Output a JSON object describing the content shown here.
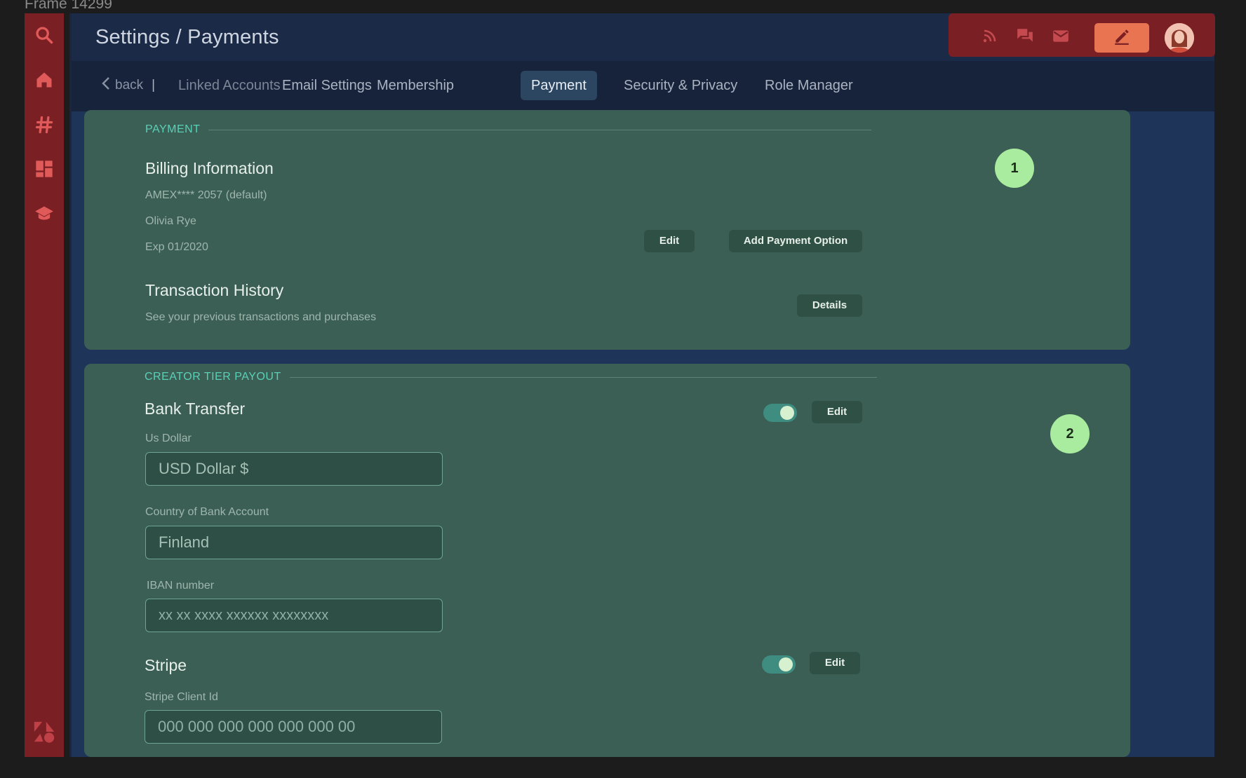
{
  "frame_label": "Frame 14299",
  "sidebar": {
    "icons": [
      "search-icon",
      "home-icon",
      "hashtag-icon",
      "dashboard-icon",
      "graduation-cap-icon",
      "shapes-logo-icon"
    ]
  },
  "header": {
    "title": "Settings / Payments",
    "actions": [
      "rss-icon",
      "chat-icon",
      "mail-icon",
      "edit-icon",
      "avatar"
    ]
  },
  "tabs": {
    "back_label": "back",
    "separator": "|",
    "items": [
      {
        "label": "Linked Accounts"
      },
      {
        "label": "Email Settings"
      },
      {
        "label": "Membership"
      },
      {
        "label": "Payment",
        "active": true
      },
      {
        "label": "Security & Privacy"
      },
      {
        "label": "Role Manager"
      }
    ]
  },
  "payment": {
    "section_title": "PAYMENT",
    "badge": "1",
    "billing": {
      "title": "Billing Information",
      "card": "AMEX**** 2057 (default)",
      "name": "Olivia Rye",
      "expiry": "Exp 01/2020",
      "edit_label": "Edit",
      "add_label": "Add Payment Option"
    },
    "history": {
      "title": "Transaction History",
      "description": "See your previous transactions and purchases",
      "details_label": "Details"
    }
  },
  "payout": {
    "section_title": "CREATOR TIER PAYOUT",
    "badge": "2",
    "bank": {
      "title": "Bank Transfer",
      "enabled": true,
      "edit_label": "Edit",
      "currency_label": "Us Dollar",
      "currency_value": "USD Dollar $",
      "country_label": "Country of Bank Account",
      "country_value": "Finland",
      "iban_label": "IBAN number",
      "iban_placeholder": "xx xx xxxx xxxxxx xxxxxxxx"
    },
    "stripe": {
      "title": "Stripe",
      "enabled": true,
      "edit_label": "Edit",
      "client_id_label": "Stripe Client Id",
      "client_id_placeholder": "000 000 000 000 000 000 00"
    }
  },
  "colors": {
    "sidebar": "#7a2025",
    "accent": "#e97451",
    "card": "#3b5f55",
    "section_head": "#5ad0b7",
    "badge": "#a9ec9f"
  }
}
